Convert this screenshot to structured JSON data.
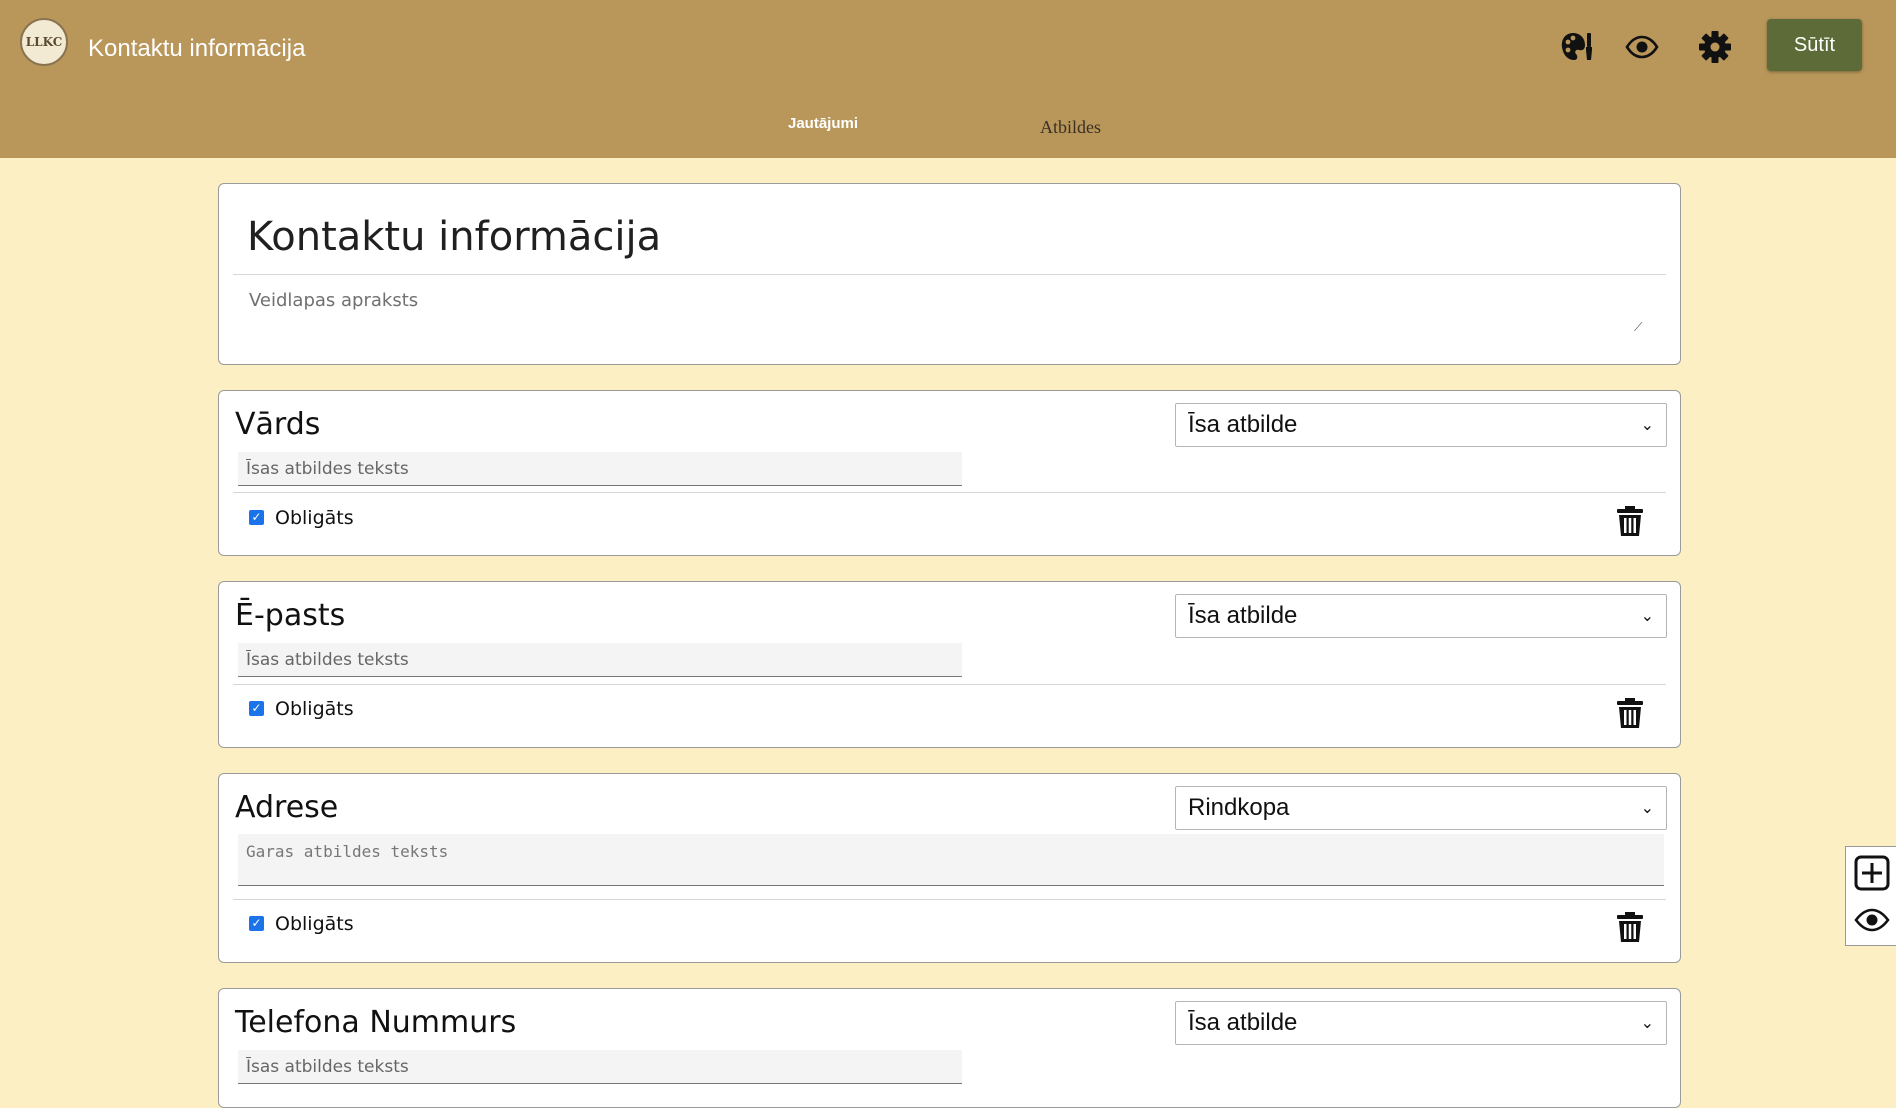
{
  "header": {
    "app_title": "Kontaktu informācija",
    "logo_text": "LLKC",
    "send_label": "Sūtīt",
    "icons": [
      "palette-icon",
      "eye-icon",
      "gear-icon"
    ],
    "tabs": [
      {
        "label": "Jautājumi",
        "active": true
      },
      {
        "label": "Atbildes",
        "active": false
      }
    ],
    "bg_color": "#b9975b",
    "send_color": "#5c6b38"
  },
  "form": {
    "title": "Kontaktu informācija",
    "description_placeholder": "Veidlapas apraksts"
  },
  "questions": [
    {
      "title": "Vārds",
      "type": "Īsa atbilde",
      "answer_placeholder": "Īsas atbildes teksts",
      "required_label": "Obligāts",
      "required": true
    },
    {
      "title": "Ē-pasts",
      "type": "Īsa atbilde",
      "answer_placeholder": "Īsas atbildes teksts",
      "required_label": "Obligāts",
      "required": true
    },
    {
      "title": "Adrese",
      "type": "Rindkopa",
      "answer_placeholder": "Garas atbildes teksts",
      "required_label": "Obligāts",
      "required": true
    },
    {
      "title": "Telefona Nummurs",
      "type": "Īsa atbilde",
      "answer_placeholder": "Īsas atbildes teksts"
    }
  ],
  "side_tools": [
    "add-question-icon",
    "preview-eye-icon"
  ],
  "page_bg": "#fdefc4"
}
